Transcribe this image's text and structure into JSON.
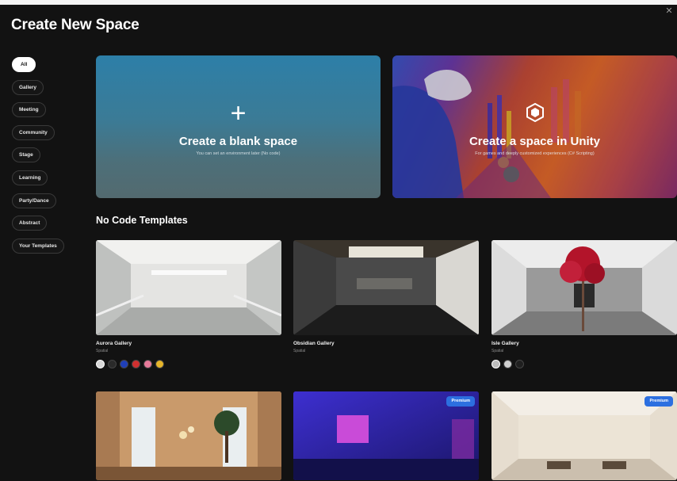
{
  "page": {
    "title": "Create New Space"
  },
  "sidebar": {
    "items": [
      {
        "label": "All",
        "active": true
      },
      {
        "label": "Gallery"
      },
      {
        "label": "Meeting"
      },
      {
        "label": "Community"
      },
      {
        "label": "Stage"
      },
      {
        "label": "Learning"
      },
      {
        "label": "Party/Dance"
      },
      {
        "label": "Abstract"
      },
      {
        "label": "Your Templates"
      }
    ]
  },
  "hero": {
    "blank": {
      "title": "Create a blank space",
      "subtitle": "You can set an environment later (No code)",
      "icon": "plus-icon"
    },
    "unity": {
      "title": "Create a space in Unity",
      "subtitle": "For games and deeply customized experiences (C# Scripting)",
      "icon": "unity-icon"
    }
  },
  "section": {
    "title": "No Code Templates"
  },
  "templates": [
    {
      "name": "Aurora Gallery",
      "subtitle": "Spatial",
      "swatches": [
        "#d8d8d8",
        "#2a2a2a",
        "#1f3fb8",
        "#d03030",
        "#e67a9a",
        "#e6b52a"
      ]
    },
    {
      "name": "Obsidian Gallery",
      "subtitle": "Spatial"
    },
    {
      "name": "Isle Gallery",
      "subtitle": "Spatial",
      "swatches": [
        "#bdbdbd",
        "#d0d0d0",
        "#1f1f1f"
      ]
    },
    {
      "name": "",
      "subtitle": ""
    },
    {
      "name": "",
      "subtitle": "",
      "badge": "Premium"
    },
    {
      "name": "",
      "subtitle": "",
      "badge": "Premium"
    }
  ],
  "colors": {
    "background": "#121212",
    "accent": "#2c6fe0",
    "text": "#ffffff"
  }
}
